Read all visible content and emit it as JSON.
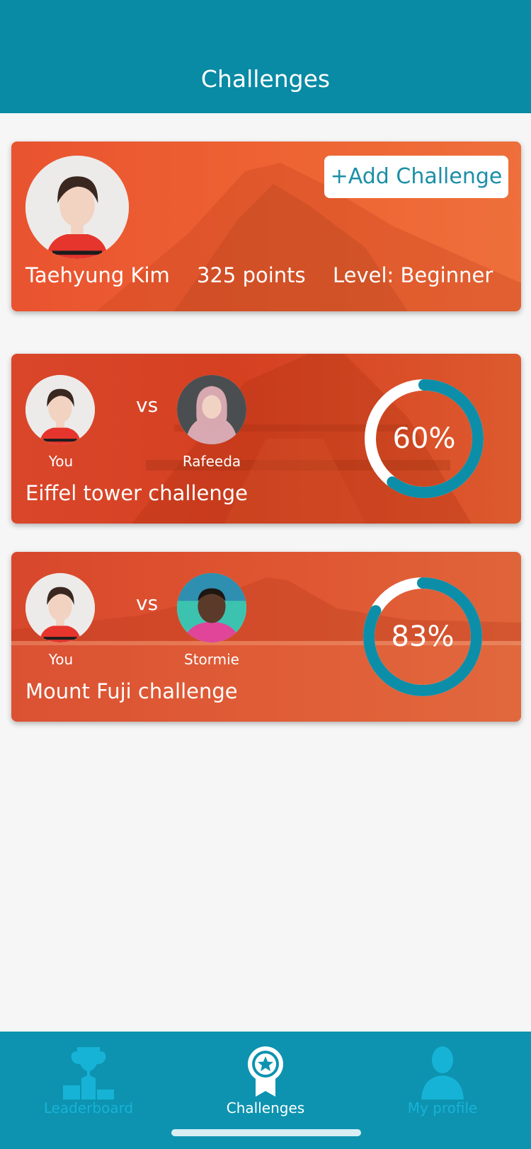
{
  "header": {
    "title": "Challenges"
  },
  "colors": {
    "header": "#098aa5",
    "tab_bar": "#0d93b0",
    "accent": "#1b8fa6",
    "ring_progress": "#0d8ea8",
    "card_orange": "#ee6433"
  },
  "profile": {
    "name": "Taehyung Kim",
    "points": "325 points",
    "level": "Level: Beginner",
    "add_button_label": "+Add Challenge"
  },
  "challenges": [
    {
      "you_label": "You",
      "vs_label": "vs",
      "opponent": "Rafeeda",
      "title": "Eiffel tower challenge",
      "progress_text": "60%",
      "progress": 0.6
    },
    {
      "you_label": "You",
      "vs_label": "vs",
      "opponent": "Stormie",
      "title": "Mount Fuji challenge",
      "progress_text": "83%",
      "progress": 0.83
    }
  ],
  "tabs": [
    {
      "label": "Leaderboard",
      "icon": "trophy-podium-icon",
      "active": false
    },
    {
      "label": "Challenges",
      "icon": "star-badge-icon",
      "active": true
    },
    {
      "label": "My profile",
      "icon": "person-icon",
      "active": false
    }
  ]
}
